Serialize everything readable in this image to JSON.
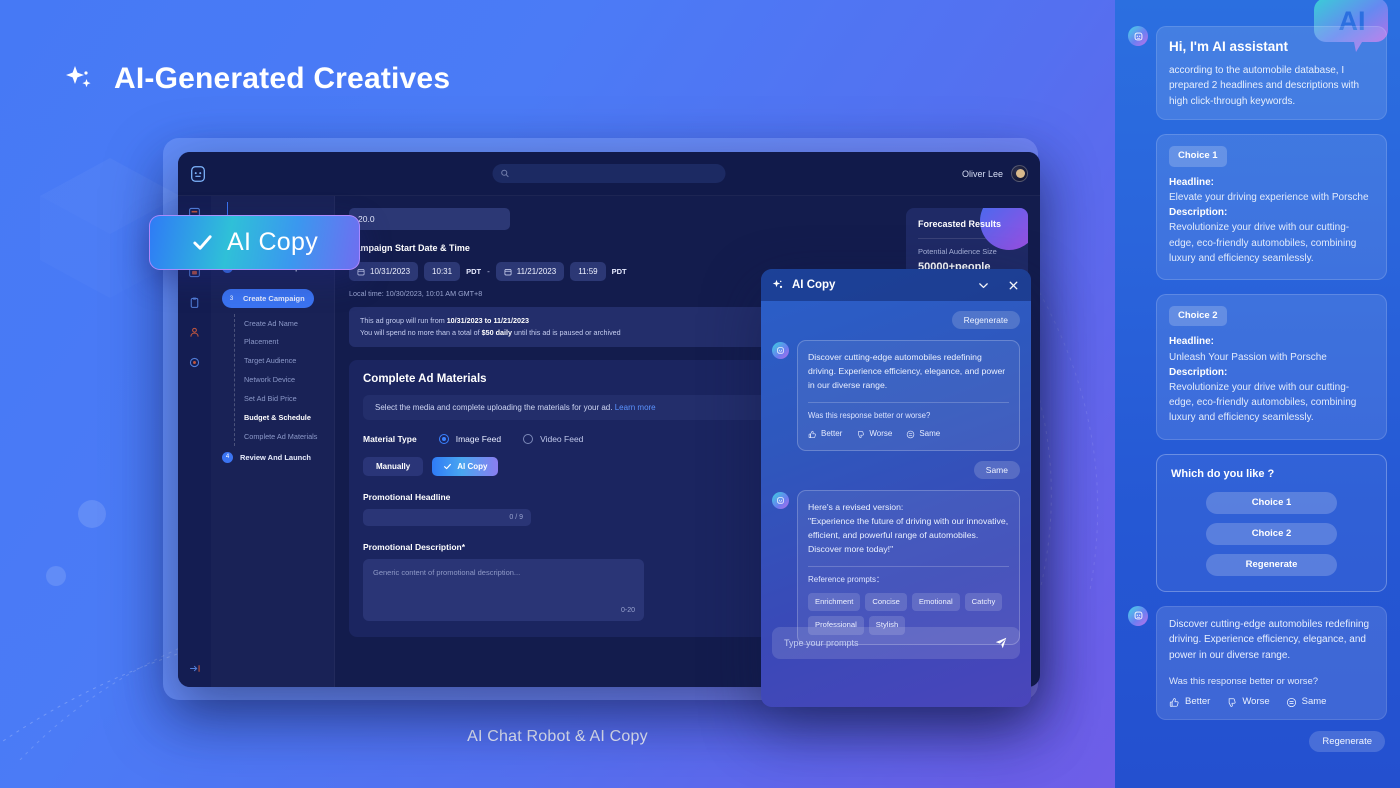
{
  "page": {
    "title": "AI-Generated Creatives",
    "caption": "AI Chat Robot & AI Copy",
    "spark_icon": "sparkle-icon"
  },
  "floating_badge": {
    "label": "AI Copy",
    "icon": "check-icon"
  },
  "app": {
    "topbar": {
      "logo_icon": "robot-icon",
      "search_icon": "search-icon",
      "search_placeholder": "",
      "user_name": "Oliver Lee",
      "avatar_icon": "avatar"
    },
    "rail_icons": [
      "dashboard-icon",
      "campaign-icon",
      "image-icon",
      "clipboard-icon",
      "person-icon",
      "settings-icon",
      "collapse-icon"
    ],
    "steps": {
      "completed": {
        "label": "Create Ad Group",
        "icon": "check-circle-icon"
      },
      "current": {
        "number": "3",
        "label": "Create Campaign"
      },
      "substeps": [
        {
          "label": "Create Ad Name",
          "active": false
        },
        {
          "label": "Placement",
          "active": false
        },
        {
          "label": "Target Audience",
          "active": false
        },
        {
          "label": "Network Device",
          "active": false
        },
        {
          "label": "Set Ad Bid Price",
          "active": false
        },
        {
          "label": "Budget & Schedule",
          "active": true
        },
        {
          "label": "Complete Ad Materials",
          "active": false
        }
      ],
      "next": {
        "number": "4",
        "label": "Review And Launch"
      }
    },
    "budget": {
      "amount_value": "20.0",
      "section_title": "Campaign Start Date & Time",
      "start_date": "10/31/2023",
      "start_time": "10:31",
      "start_tz": "PDT",
      "separator": "-",
      "end_date": "11/21/2023",
      "end_time": "11:59",
      "end_tz": "PDT",
      "local_time": "Local time: 10/30/2023, 10:01 AM GMT+8",
      "notice_line1_pre": "This ad group will run from ",
      "notice_line1_bold": "10/31/2023 to 11/21/2023",
      "notice_line2_pre": "You will spend no more than a total of ",
      "notice_line2_bold": "$50 daily",
      "notice_line2_post": " until this ad is paused or archived",
      "calendar_icon": "calendar-icon"
    },
    "materials": {
      "title": "Complete Ad Materials",
      "hint_text": "Select the media and complete uploading the materials for your ad.",
      "hint_link": "Learn more",
      "material_type_label": "Material Type",
      "options": [
        {
          "label": "Image Feed",
          "selected": true
        },
        {
          "label": "Video Feed",
          "selected": false
        }
      ],
      "manual_button": "Manually",
      "aicopy_button": "AI Copy",
      "headline_label": "Promotional Headline",
      "headline_counter": "0 / 9",
      "description_label": "Promotional Description*",
      "description_placeholder": "Generic content of promotional description...",
      "description_counter": "0-20"
    },
    "forecast": {
      "title": "Forecasted Results",
      "metric_label": "Potential Audience Size",
      "metric_value": "50000+people"
    }
  },
  "modal": {
    "title": "AI Copy",
    "sparkle_icon": "sparkle-icon",
    "collapse_icon": "chevron-down-icon",
    "close_icon": "close-icon",
    "regenerate_label": "Regenerate",
    "same_label": "Same",
    "message1": {
      "text": "Discover cutting-edge automobiles redefining driving. Experience efficiency, elegance, and power in our diverse range.",
      "feedback_question": "Was this response better or worse?",
      "feedback": [
        {
          "label": "Better",
          "icon": "thumbs-up-icon"
        },
        {
          "label": "Worse",
          "icon": "thumbs-down-icon"
        },
        {
          "label": "Same",
          "icon": "equals-circle-icon"
        }
      ]
    },
    "message2": {
      "line1": "Here's a revised version:",
      "line2": "\"Experience the future of driving with our innovative, efficient, and powerful range of automobiles. Discover more today!\"",
      "reference_label": "Reference prompts：",
      "tags": [
        "Enrichment",
        "Concise",
        "Emotional",
        "Catchy",
        "Professional",
        "Stylish"
      ]
    },
    "composer": {
      "placeholder": "Type your prompts",
      "send_icon": "send-icon"
    }
  },
  "assistant": {
    "logo_text": "AI",
    "greeting": {
      "heading": "Hi, I'm AI assistant",
      "body": "according to the automobile database, I prepared 2 headlines and descriptions with high click-through keywords."
    },
    "choices": [
      {
        "badge": "Choice 1",
        "headline_label": "Headline:",
        "headline": "Elevate your driving experience with Porsche",
        "description_label": "Description:",
        "description": "Revolutionize your drive with our cutting-edge, eco-friendly automobiles, combining luxury and efficiency seamlessly."
      },
      {
        "badge": "Choice 2",
        "headline_label": "Headline:",
        "headline": "Unleash Your Passion with Porsche",
        "description_label": "Description:",
        "description": "Revolutionize your drive with our cutting-edge, eco-friendly automobiles, combining luxury and efficiency seamlessly."
      }
    ],
    "ask": {
      "question": "Which do you like ?",
      "buttons": [
        "Choice 1",
        "Choice 2",
        "Regenerate"
      ]
    },
    "final": {
      "text": "Discover cutting-edge automobiles redefining driving. Experience efficiency, elegance, and power in our diverse range.",
      "feedback_question": "Was this response better or worse?",
      "feedback": [
        {
          "label": "Better",
          "icon": "thumbs-up-icon"
        },
        {
          "label": "Worse",
          "icon": "thumbs-down-icon"
        },
        {
          "label": "Same",
          "icon": "equals-circle-icon"
        }
      ],
      "regenerate_label": "Regenerate"
    }
  },
  "colors": {
    "background_start": "#4679f5",
    "background_end": "#7a5ce6",
    "accent_blue": "#3b74f2",
    "panel_dark": "#131c4d",
    "card_dark": "#1b2560",
    "link": "#5b93ff"
  }
}
